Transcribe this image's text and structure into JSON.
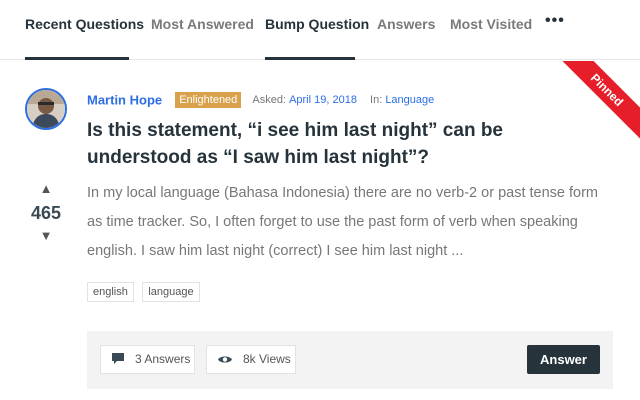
{
  "tabs": [
    {
      "label": "Recent Questions",
      "active": true
    },
    {
      "label": "Most Answered",
      "active": false
    },
    {
      "label": "Bump Question",
      "active": true
    },
    {
      "label": "Answers",
      "active": false
    },
    {
      "label": "Most Visited",
      "active": false
    }
  ],
  "tabs_more_label": "•••",
  "question": {
    "pinned_label": "Pinned",
    "author": "Martin Hope",
    "badge": "Enlightened",
    "asked_label": "Asked:",
    "asked_date": "April 19, 2018",
    "in_label": "In:",
    "category": "Language",
    "title": "Is this statement, “i see him last night” can be understood as “I saw him last night”?",
    "votes": "465",
    "excerpt": "In my local language (Bahasa Indonesia) there are no verb-2 or past tense form as time tracker. So, I often forget to use the past form of verb when speaking english. I saw him last night (correct) I see him last night ...",
    "tags": [
      "english",
      "language"
    ],
    "answers_count": "3 Answers",
    "views": "8k Views",
    "answer_button": "Answer"
  },
  "colors": {
    "accent": "#2d6ee3",
    "pinned": "#e51e2a",
    "badge": "#d9a14b",
    "dark": "#26333b"
  },
  "icons": {
    "vote_up": "triangle-up-icon",
    "vote_down": "triangle-down-icon",
    "answers": "comment-icon",
    "views": "eye-icon",
    "more": "more-dots-icon"
  }
}
